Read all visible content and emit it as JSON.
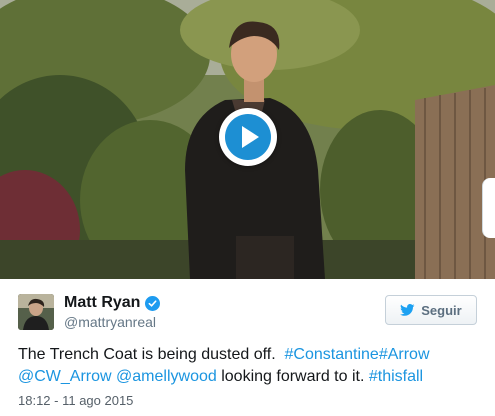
{
  "tweet": {
    "author_name": "Matt Ryan",
    "author_handle": "@mattryanreal",
    "follow_label": "Seguir",
    "text_before": "The Trench Coat is being dusted off.",
    "hashtag_1": "#Constantine",
    "hashtag_2": "#Arrow",
    "mention_1": "@CW_Arrow",
    "mention_2": "@amellywood",
    "text_middle": "looking forward to it.",
    "hashtag_3": "#thisfall",
    "timestamp": "18:12 - 11 ago 2015"
  },
  "colors": {
    "link": "#1b95e0",
    "play_button": "#1d8fd3",
    "verified_badge": "#1d9bf0",
    "follow_text": "#5c6f80"
  },
  "icons": {
    "play": "play-icon",
    "verified": "verified-badge-icon",
    "follow": "twitter-bird-icon"
  }
}
